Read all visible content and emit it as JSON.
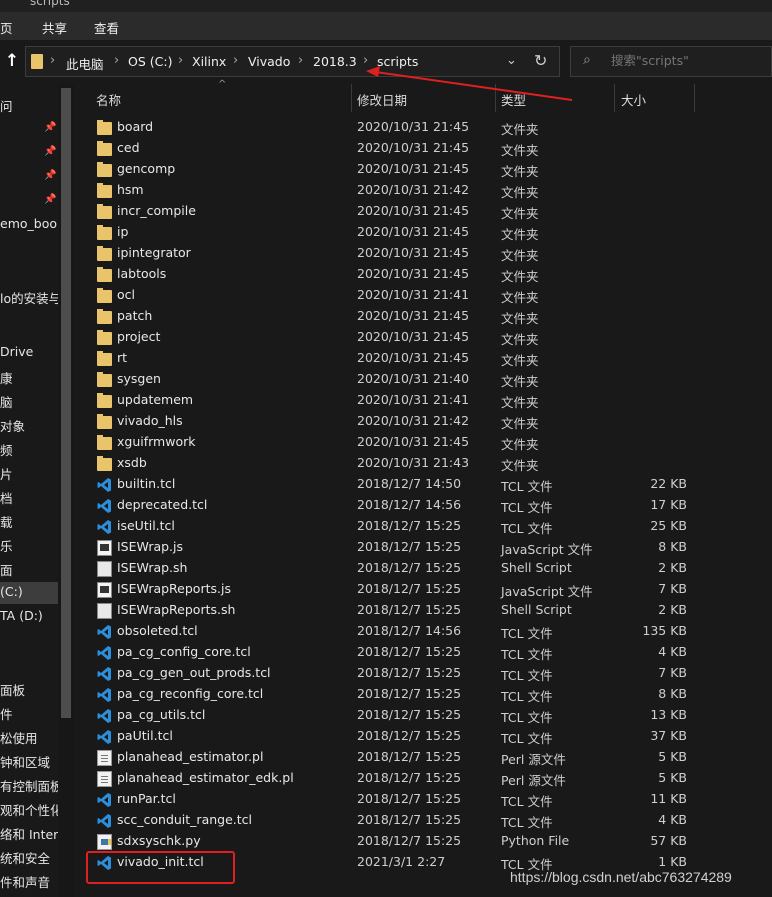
{
  "window": {
    "title": "scripts"
  },
  "ribbon": {
    "tabs": [
      "页",
      "共享",
      "查看"
    ]
  },
  "address": {
    "crumbs": [
      "此电脑",
      "OS (C:)",
      "Xilinx",
      "Vivado",
      "2018.3",
      "scripts"
    ]
  },
  "search": {
    "placeholder": "搜索\"scripts\""
  },
  "nav": {
    "items": [
      "问",
      "emo_book",
      "lo的安装与",
      "Drive",
      "康",
      "脑",
      "对象",
      "频",
      "片",
      "档",
      "载",
      "乐",
      "面",
      "(C:)",
      "TA (D:)",
      "面板",
      "件",
      "松使用",
      "钟和区域",
      "有控制面板项",
      "观和个性化",
      "络和 Interne",
      "统和安全",
      "件和声音"
    ]
  },
  "columns": {
    "name": "名称",
    "date": "修改日期",
    "type": "类型",
    "size": "大小"
  },
  "files": [
    {
      "name": "board",
      "date": "2020/10/31 21:45",
      "type": "文件夹",
      "size": "",
      "icon": "folder-icon"
    },
    {
      "name": "ced",
      "date": "2020/10/31 21:45",
      "type": "文件夹",
      "size": "",
      "icon": "folder-icon"
    },
    {
      "name": "gencomp",
      "date": "2020/10/31 21:45",
      "type": "文件夹",
      "size": "",
      "icon": "folder-icon"
    },
    {
      "name": "hsm",
      "date": "2020/10/31 21:42",
      "type": "文件夹",
      "size": "",
      "icon": "folder-icon"
    },
    {
      "name": "incr_compile",
      "date": "2020/10/31 21:45",
      "type": "文件夹",
      "size": "",
      "icon": "folder-icon"
    },
    {
      "name": "ip",
      "date": "2020/10/31 21:45",
      "type": "文件夹",
      "size": "",
      "icon": "folder-icon"
    },
    {
      "name": "ipintegrator",
      "date": "2020/10/31 21:45",
      "type": "文件夹",
      "size": "",
      "icon": "folder-icon"
    },
    {
      "name": "labtools",
      "date": "2020/10/31 21:45",
      "type": "文件夹",
      "size": "",
      "icon": "folder-icon"
    },
    {
      "name": "ocl",
      "date": "2020/10/31 21:41",
      "type": "文件夹",
      "size": "",
      "icon": "folder-icon"
    },
    {
      "name": "patch",
      "date": "2020/10/31 21:45",
      "type": "文件夹",
      "size": "",
      "icon": "folder-icon"
    },
    {
      "name": "project",
      "date": "2020/10/31 21:45",
      "type": "文件夹",
      "size": "",
      "icon": "folder-icon"
    },
    {
      "name": "rt",
      "date": "2020/10/31 21:45",
      "type": "文件夹",
      "size": "",
      "icon": "folder-icon"
    },
    {
      "name": "sysgen",
      "date": "2020/10/31 21:40",
      "type": "文件夹",
      "size": "",
      "icon": "folder-icon"
    },
    {
      "name": "updatemem",
      "date": "2020/10/31 21:41",
      "type": "文件夹",
      "size": "",
      "icon": "folder-icon"
    },
    {
      "name": "vivado_hls",
      "date": "2020/10/31 21:42",
      "type": "文件夹",
      "size": "",
      "icon": "folder-icon"
    },
    {
      "name": "xguifrmwork",
      "date": "2020/10/31 21:45",
      "type": "文件夹",
      "size": "",
      "icon": "folder-icon"
    },
    {
      "name": "xsdb",
      "date": "2020/10/31 21:43",
      "type": "文件夹",
      "size": "",
      "icon": "folder-icon"
    },
    {
      "name": "builtin.tcl",
      "date": "2018/12/7 14:50",
      "type": "TCL 文件",
      "size": "22 KB",
      "icon": "vscode-icon"
    },
    {
      "name": "deprecated.tcl",
      "date": "2018/12/7 14:56",
      "type": "TCL 文件",
      "size": "17 KB",
      "icon": "vscode-icon"
    },
    {
      "name": "iseUtil.tcl",
      "date": "2018/12/7 15:25",
      "type": "TCL 文件",
      "size": "25 KB",
      "icon": "vscode-icon"
    },
    {
      "name": "ISEWrap.js",
      "date": "2018/12/7 15:25",
      "type": "JavaScript 文件",
      "size": "8 KB",
      "icon": "script-icon"
    },
    {
      "name": "ISEWrap.sh",
      "date": "2018/12/7 15:25",
      "type": "Shell Script",
      "size": "2 KB",
      "icon": "shell-icon"
    },
    {
      "name": "ISEWrapReports.js",
      "date": "2018/12/7 15:25",
      "type": "JavaScript 文件",
      "size": "7 KB",
      "icon": "script-icon"
    },
    {
      "name": "ISEWrapReports.sh",
      "date": "2018/12/7 15:25",
      "type": "Shell Script",
      "size": "2 KB",
      "icon": "shell-icon"
    },
    {
      "name": "obsoleted.tcl",
      "date": "2018/12/7 14:56",
      "type": "TCL 文件",
      "size": "135 KB",
      "icon": "vscode-icon"
    },
    {
      "name": "pa_cg_config_core.tcl",
      "date": "2018/12/7 15:25",
      "type": "TCL 文件",
      "size": "4 KB",
      "icon": "vscode-icon"
    },
    {
      "name": "pa_cg_gen_out_prods.tcl",
      "date": "2018/12/7 15:25",
      "type": "TCL 文件",
      "size": "7 KB",
      "icon": "vscode-icon"
    },
    {
      "name": "pa_cg_reconfig_core.tcl",
      "date": "2018/12/7 15:25",
      "type": "TCL 文件",
      "size": "8 KB",
      "icon": "vscode-icon"
    },
    {
      "name": "pa_cg_utils.tcl",
      "date": "2018/12/7 15:25",
      "type": "TCL 文件",
      "size": "13 KB",
      "icon": "vscode-icon"
    },
    {
      "name": "paUtil.tcl",
      "date": "2018/12/7 15:25",
      "type": "TCL 文件",
      "size": "37 KB",
      "icon": "vscode-icon"
    },
    {
      "name": "planahead_estimator.pl",
      "date": "2018/12/7 15:25",
      "type": "Perl 源文件",
      "size": "5 KB",
      "icon": "perl-icon"
    },
    {
      "name": "planahead_estimator_edk.pl",
      "date": "2018/12/7 15:25",
      "type": "Perl 源文件",
      "size": "5 KB",
      "icon": "perl-icon"
    },
    {
      "name": "runPar.tcl",
      "date": "2018/12/7 15:25",
      "type": "TCL 文件",
      "size": "11 KB",
      "icon": "vscode-icon"
    },
    {
      "name": "scc_conduit_range.tcl",
      "date": "2018/12/7 15:25",
      "type": "TCL 文件",
      "size": "4 KB",
      "icon": "vscode-icon"
    },
    {
      "name": "sdxsyschk.py",
      "date": "2018/12/7 15:25",
      "type": "Python File",
      "size": "57 KB",
      "icon": "python-icon"
    },
    {
      "name": "vivado_init.tcl",
      "date": "2021/3/1 2:27",
      "type": "TCL 文件",
      "size": "1 KB",
      "icon": "vscode-icon"
    }
  ],
  "watermark": "https://blog.csdn.net/abc763274289",
  "colors": {
    "background": "#191919",
    "folder": "#e9c46a",
    "vscode": "#2b8fdc",
    "annotation": "#e02020"
  }
}
